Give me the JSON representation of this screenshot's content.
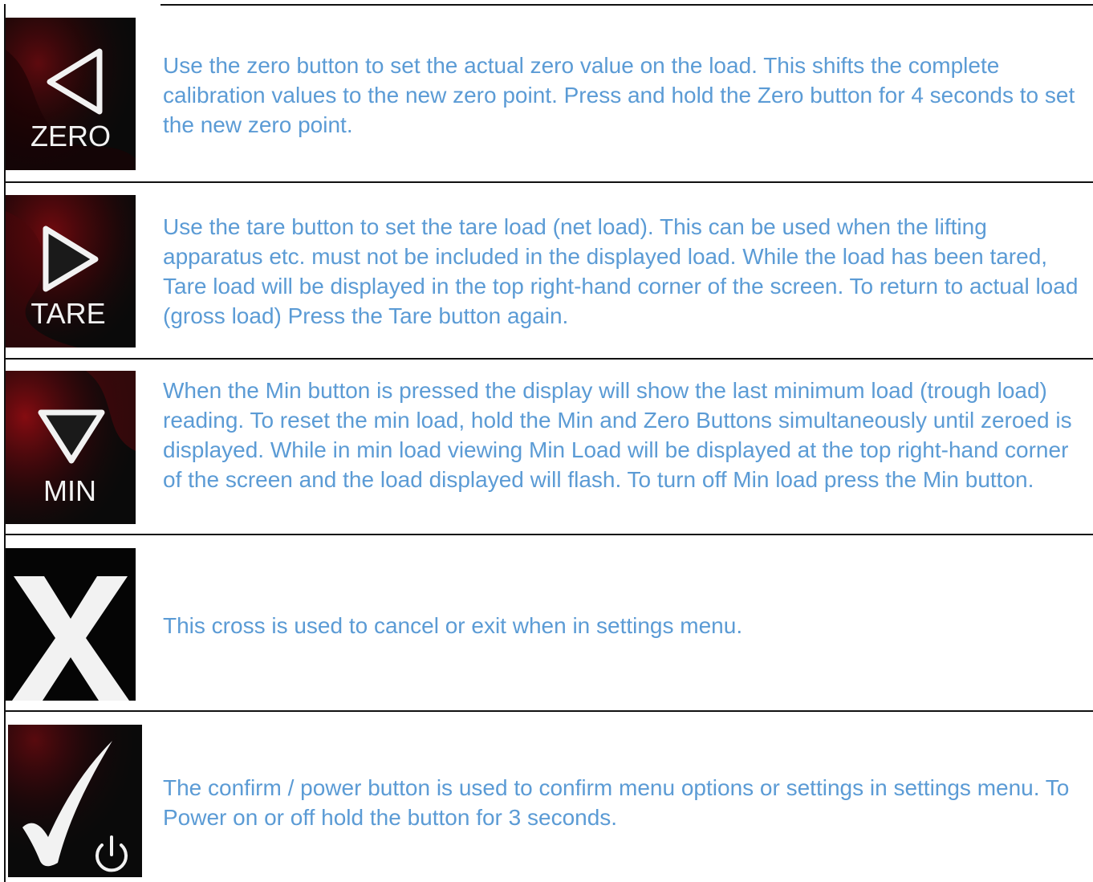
{
  "rows": [
    {
      "button_label": "ZERO",
      "icon": "left-triangle-icon",
      "description": "Use the zero button to set the actual zero value on the load. This shifts the complete calibration values to the new zero point. Press and hold the Zero button for 4 seconds to set the new zero point."
    },
    {
      "button_label": "TARE",
      "icon": "right-triangle-icon",
      "description": "Use the tare button to set the tare load (net load). This can be used when the lifting apparatus etc. must not be included in the displayed load. While the load has been tared, Tare load will be displayed in the top right-hand corner of the screen. To return to actual load (gross load) Press the Tare button again."
    },
    {
      "button_label": "MIN",
      "icon": "down-triangle-icon",
      "description": "When the Min button is pressed the display will show the last minimum load (trough load) reading. To reset the min load, hold the Min and Zero Buttons simultaneously until zeroed is displayed. While in min load viewing Min Load will be displayed at the top right-hand corner of the screen and the load displayed will flash. To turn off Min load press the Min button."
    },
    {
      "button_label": "",
      "icon": "cross-icon",
      "description": "This cross is used to cancel or exit when in settings menu."
    },
    {
      "button_label": "",
      "icon": "checkmark-power-icon",
      "description": "The confirm / power button is used to confirm menu options or settings in settings menu. To Power on or off hold the button for 3 seconds."
    }
  ],
  "colors": {
    "text": "#5b9bd5",
    "rule": "#111111",
    "button_bg": "#0a0a0a",
    "button_glow": "#8b0a10",
    "glyph": "#f2f2f2"
  }
}
